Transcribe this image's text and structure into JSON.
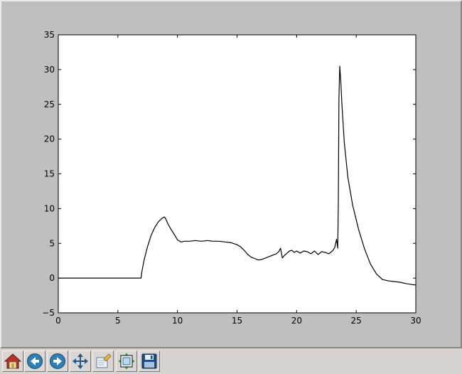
{
  "colors": {
    "figure_bg": "#bfbfbf",
    "axes_bg": "#ffffff",
    "line": "#000000",
    "toolbar_bg": "#d6d2d0"
  },
  "toolbar": {
    "buttons": [
      {
        "icon": "home-icon"
      },
      {
        "icon": "back-arrow-icon"
      },
      {
        "icon": "forward-arrow-icon"
      },
      {
        "icon": "pan-move-icon"
      },
      {
        "icon": "zoom-rect-icon"
      },
      {
        "icon": "configure-subplots-icon"
      },
      {
        "icon": "save-floppy-icon"
      }
    ]
  },
  "chart_data": {
    "type": "line",
    "title": "",
    "xlabel": "",
    "ylabel": "",
    "xlim": [
      0,
      30
    ],
    "ylim": [
      -5,
      35
    ],
    "xticks": [
      0,
      5,
      10,
      15,
      20,
      25,
      30
    ],
    "yticks": [
      -5,
      0,
      5,
      10,
      15,
      20,
      25,
      30,
      35
    ],
    "xtick_labels": [
      "0",
      "5",
      "10",
      "15",
      "20",
      "25",
      "30"
    ],
    "ytick_labels": [
      "−5",
      "0",
      "5",
      "10",
      "15",
      "20",
      "25",
      "30",
      "35"
    ],
    "grid": false,
    "legend": "none",
    "series": [
      {
        "x": [
          0,
          2,
          4,
          5.4,
          6.5,
          6.95,
          7.0,
          7.2,
          7.5,
          7.8,
          8.1,
          8.4,
          8.7,
          8.9,
          9.0,
          9.2,
          9.5,
          9.8,
          10.0,
          10.3,
          10.6,
          11.0,
          11.5,
          12.0,
          12.5,
          13.0,
          13.5,
          14.0,
          14.5,
          15.0,
          15.3,
          15.6,
          15.9,
          16.2,
          16.5,
          16.8,
          17.1,
          17.4,
          17.7,
          18.0,
          18.3,
          18.5,
          18.65,
          18.8,
          19.0,
          19.2,
          19.4,
          19.6,
          19.8,
          20.0,
          20.3,
          20.6,
          20.9,
          21.2,
          21.5,
          21.8,
          22.1,
          22.4,
          22.7,
          23.0,
          23.2,
          23.35,
          23.45,
          23.5,
          23.55,
          23.62,
          23.7,
          23.8,
          24.0,
          24.3,
          24.7,
          25.2,
          25.7,
          26.2,
          26.7,
          27.2,
          27.7,
          28.2,
          28.7,
          29.2,
          29.6,
          30.0
        ],
        "y": [
          0,
          0,
          0,
          0,
          0,
          0,
          0.8,
          2.6,
          4.6,
          6.2,
          7.3,
          8.1,
          8.6,
          8.8,
          8.6,
          7.8,
          6.9,
          6.1,
          5.5,
          5.2,
          5.3,
          5.3,
          5.4,
          5.3,
          5.4,
          5.3,
          5.3,
          5.2,
          5.1,
          4.8,
          4.5,
          4.0,
          3.4,
          3.0,
          2.8,
          2.6,
          2.7,
          2.9,
          3.1,
          3.3,
          3.5,
          3.8,
          4.3,
          2.9,
          3.3,
          3.6,
          3.9,
          4.0,
          3.7,
          3.9,
          3.6,
          3.9,
          3.8,
          3.5,
          3.9,
          3.4,
          3.8,
          3.7,
          3.5,
          3.9,
          4.4,
          5.6,
          4.3,
          11.0,
          26.0,
          30.5,
          28.5,
          25.0,
          19.5,
          14.5,
          10.5,
          7.0,
          4.2,
          2.0,
          0.6,
          -0.2,
          -0.4,
          -0.5,
          -0.6,
          -0.8,
          -0.9,
          -1.0
        ]
      }
    ]
  }
}
